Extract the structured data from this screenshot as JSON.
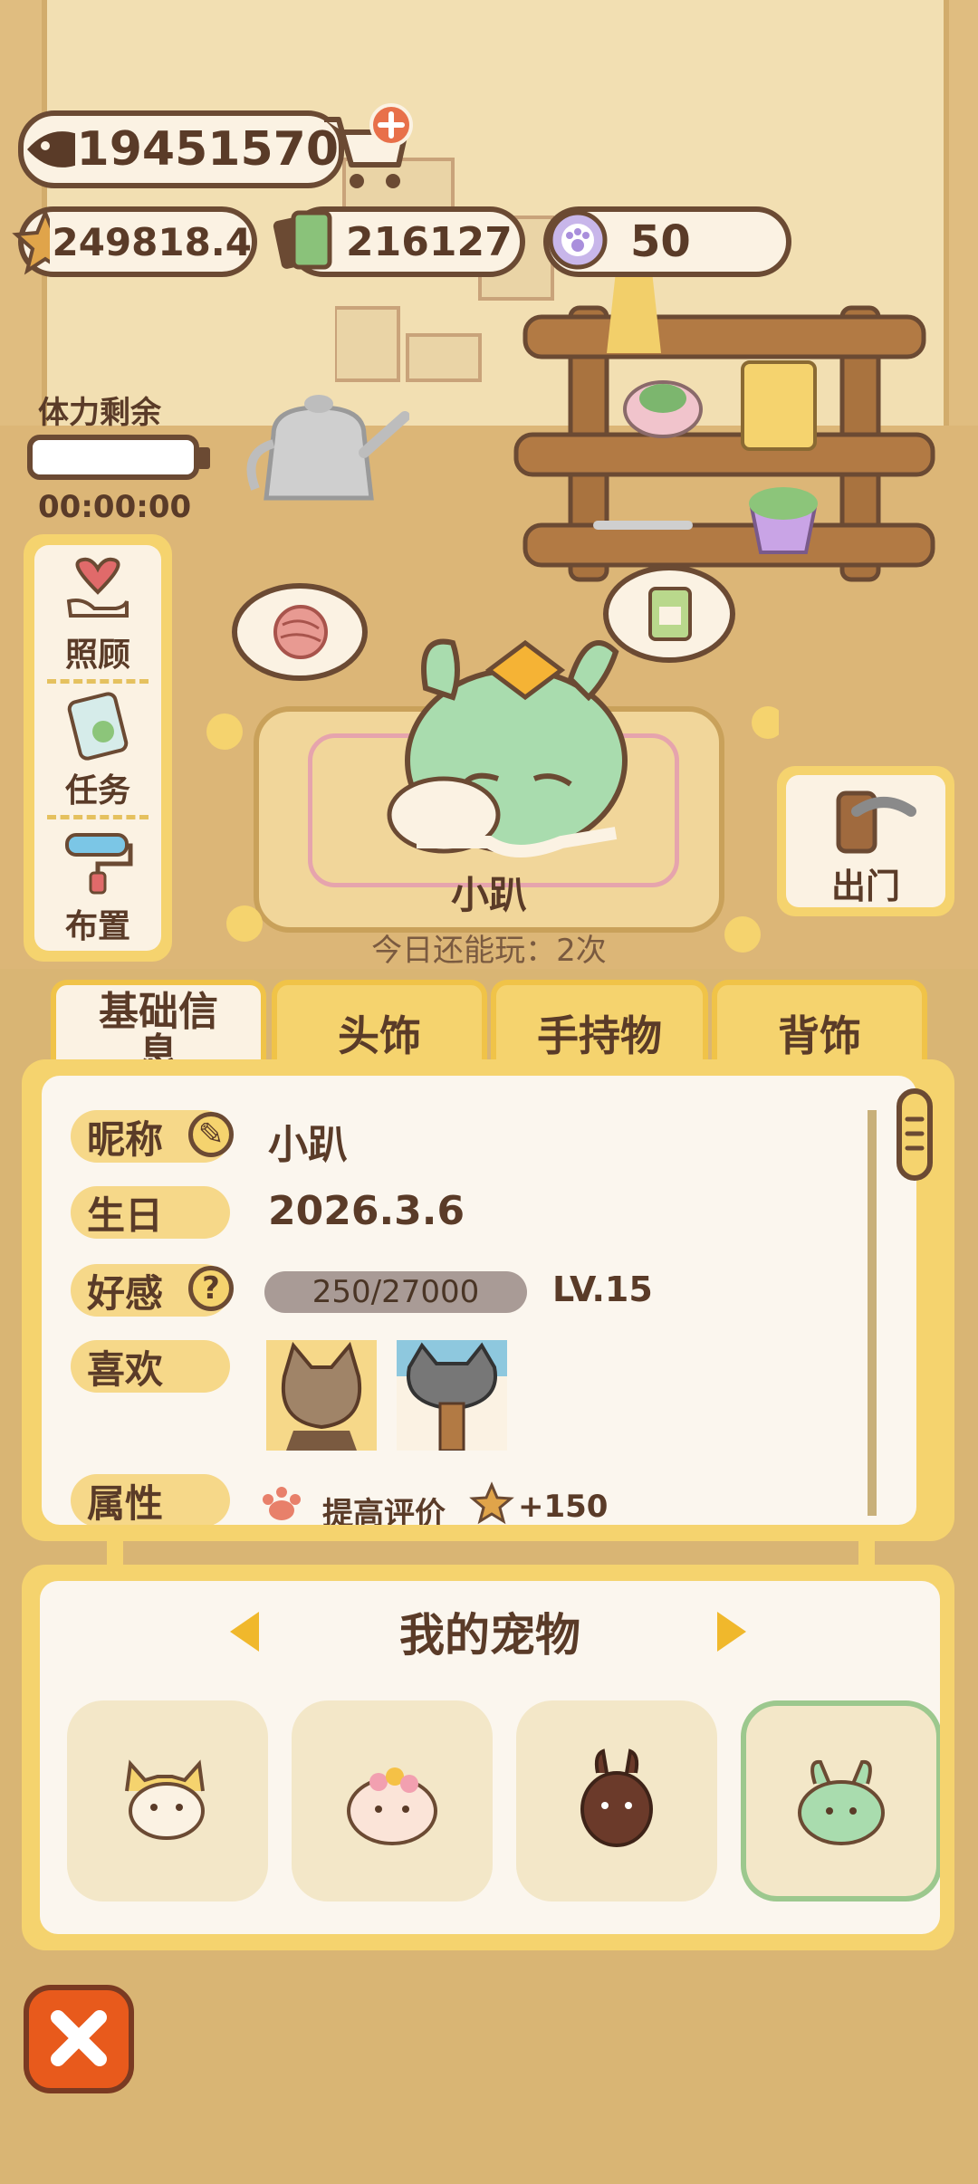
{
  "currency": {
    "fish": "19451570",
    "star": "249818.4",
    "cash": "216127",
    "paw": "50"
  },
  "stamina": {
    "label": "体力剩余",
    "time": "00:00:00"
  },
  "side_menu": {
    "care": "照顾",
    "task": "任务",
    "decorate": "布置"
  },
  "pet": {
    "name": "小趴",
    "play_left": "今日还能玩：2次"
  },
  "go_out": {
    "label": "出门"
  },
  "tabs": {
    "basic_line1": "基础信",
    "basic_line2": "息",
    "headwear": "头饰",
    "held": "手持物",
    "backwear": "背饰"
  },
  "info": {
    "nickname_label": "昵称",
    "nickname_value": "小趴",
    "birthday_label": "生日",
    "birthday_value": "2026.3.6",
    "favor_label": "好感",
    "favor_progress": "250/27000",
    "favor_level": "LV.15",
    "likes_label": "喜欢",
    "attr_label": "属性",
    "attr_text": "提高评价",
    "attr_bonus": "+150"
  },
  "pets_panel": {
    "title": "我的宠物"
  },
  "colors": {
    "accent_yellow": "#f5d36e",
    "outline_brown": "#6b4a33",
    "close_orange": "#e85a1c",
    "selected_green": "#9cc88e"
  }
}
